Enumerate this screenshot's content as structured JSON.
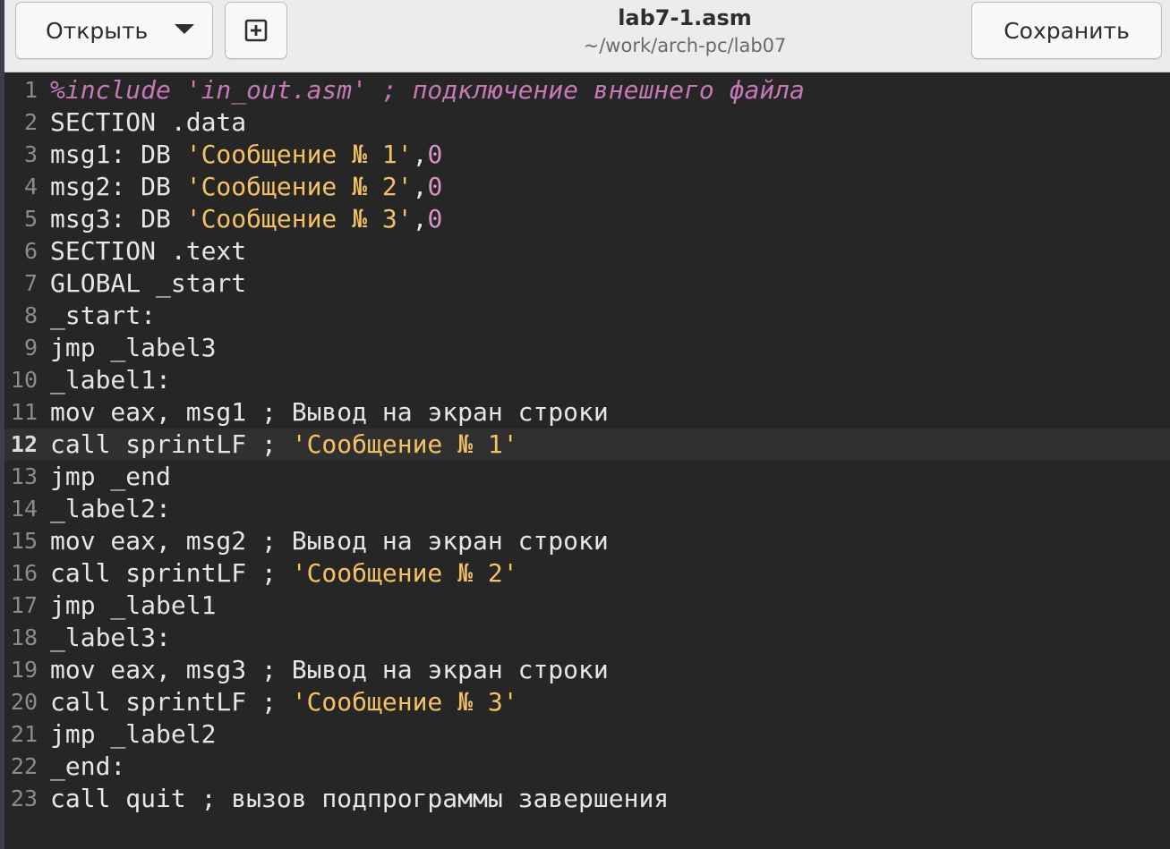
{
  "header": {
    "open_label": "Открыть",
    "new_tab_icon": "⊞",
    "title": "lab7-1.asm",
    "path": "~/work/arch-pc/lab07",
    "save_label": "Сохранить"
  },
  "editor": {
    "current_line": 12,
    "colors": {
      "background": "#262626",
      "string": "#f4c263",
      "number": "#d995c8",
      "preprocessor": "#c678b8",
      "text": "#e6e6e6"
    },
    "lines": [
      {
        "num": "1",
        "tokens": [
          {
            "t": "%include 'in_out.asm' ; подключение внешнего файла",
            "c": "pre"
          }
        ]
      },
      {
        "num": "2",
        "tokens": [
          {
            "t": "SECTION .data",
            "c": "plain"
          }
        ]
      },
      {
        "num": "3",
        "tokens": [
          {
            "t": "msg1: DB ",
            "c": "plain"
          },
          {
            "t": "'Сообщение № 1'",
            "c": "str"
          },
          {
            "t": ",",
            "c": "plain"
          },
          {
            "t": "0",
            "c": "num"
          }
        ]
      },
      {
        "num": "4",
        "tokens": [
          {
            "t": "msg2: DB ",
            "c": "plain"
          },
          {
            "t": "'Сообщение № 2'",
            "c": "str"
          },
          {
            "t": ",",
            "c": "plain"
          },
          {
            "t": "0",
            "c": "num"
          }
        ]
      },
      {
        "num": "5",
        "tokens": [
          {
            "t": "msg3: DB ",
            "c": "plain"
          },
          {
            "t": "'Сообщение № 3'",
            "c": "str"
          },
          {
            "t": ",",
            "c": "plain"
          },
          {
            "t": "0",
            "c": "num"
          }
        ]
      },
      {
        "num": "6",
        "tokens": [
          {
            "t": "SECTION .text",
            "c": "plain"
          }
        ]
      },
      {
        "num": "7",
        "tokens": [
          {
            "t": "GLOBAL _start",
            "c": "plain"
          }
        ]
      },
      {
        "num": "8",
        "tokens": [
          {
            "t": "_start:",
            "c": "plain"
          }
        ]
      },
      {
        "num": "9",
        "tokens": [
          {
            "t": "jmp _label3",
            "c": "plain"
          }
        ]
      },
      {
        "num": "10",
        "tokens": [
          {
            "t": "_label1:",
            "c": "plain"
          }
        ]
      },
      {
        "num": "11",
        "tokens": [
          {
            "t": "mov eax, msg1 ; Вывод на экран строки",
            "c": "plain"
          }
        ]
      },
      {
        "num": "12",
        "tokens": [
          {
            "t": "call sprintLF ; ",
            "c": "plain"
          },
          {
            "t": "'Сообщение № 1'",
            "c": "str"
          }
        ]
      },
      {
        "num": "13",
        "tokens": [
          {
            "t": "jmp _end",
            "c": "plain"
          }
        ]
      },
      {
        "num": "14",
        "tokens": [
          {
            "t": "_label2:",
            "c": "plain"
          }
        ]
      },
      {
        "num": "15",
        "tokens": [
          {
            "t": "mov eax, msg2 ; Вывод на экран строки",
            "c": "plain"
          }
        ]
      },
      {
        "num": "16",
        "tokens": [
          {
            "t": "call sprintLF ; ",
            "c": "plain"
          },
          {
            "t": "'Сообщение № 2'",
            "c": "str"
          }
        ]
      },
      {
        "num": "17",
        "tokens": [
          {
            "t": "jmp _label1",
            "c": "plain"
          }
        ]
      },
      {
        "num": "18",
        "tokens": [
          {
            "t": "_label3:",
            "c": "plain"
          }
        ]
      },
      {
        "num": "19",
        "tokens": [
          {
            "t": "mov eax, msg3 ; Вывод на экран строки",
            "c": "plain"
          }
        ]
      },
      {
        "num": "20",
        "tokens": [
          {
            "t": "call sprintLF ; ",
            "c": "plain"
          },
          {
            "t": "'Сообщение № 3'",
            "c": "str"
          }
        ]
      },
      {
        "num": "21",
        "tokens": [
          {
            "t": "jmp _label2",
            "c": "plain"
          }
        ]
      },
      {
        "num": "22",
        "tokens": [
          {
            "t": "_end:",
            "c": "plain"
          }
        ]
      },
      {
        "num": "23",
        "tokens": [
          {
            "t": "call quit ; вызов подпрограммы завершения",
            "c": "plain"
          }
        ]
      }
    ]
  }
}
